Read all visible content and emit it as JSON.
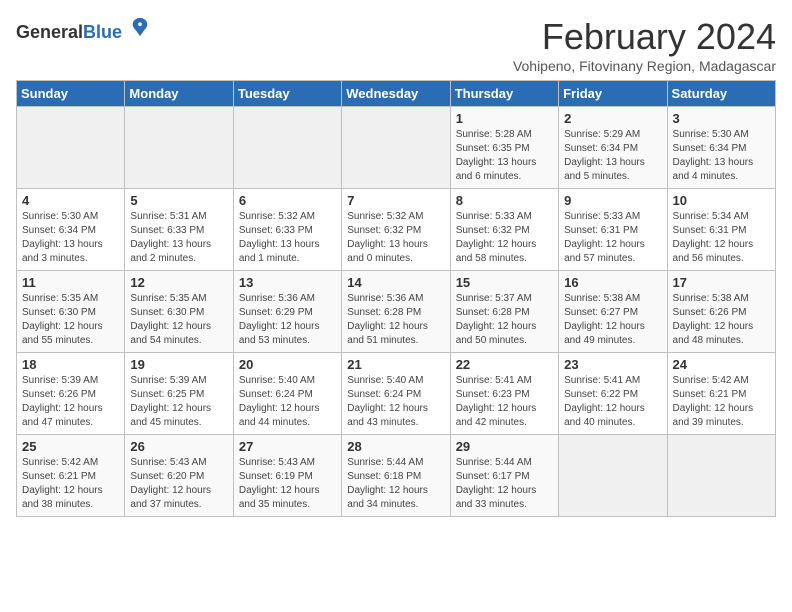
{
  "logo": {
    "general": "General",
    "blue": "Blue"
  },
  "header": {
    "month_title": "February 2024",
    "subtitle": "Vohipeno, Fitovinany Region, Madagascar"
  },
  "weekdays": [
    "Sunday",
    "Monday",
    "Tuesday",
    "Wednesday",
    "Thursday",
    "Friday",
    "Saturday"
  ],
  "weeks": [
    [
      {
        "day": "",
        "info": ""
      },
      {
        "day": "",
        "info": ""
      },
      {
        "day": "",
        "info": ""
      },
      {
        "day": "",
        "info": ""
      },
      {
        "day": "1",
        "info": "Sunrise: 5:28 AM\nSunset: 6:35 PM\nDaylight: 13 hours\nand 6 minutes."
      },
      {
        "day": "2",
        "info": "Sunrise: 5:29 AM\nSunset: 6:34 PM\nDaylight: 13 hours\nand 5 minutes."
      },
      {
        "day": "3",
        "info": "Sunrise: 5:30 AM\nSunset: 6:34 PM\nDaylight: 13 hours\nand 4 minutes."
      }
    ],
    [
      {
        "day": "4",
        "info": "Sunrise: 5:30 AM\nSunset: 6:34 PM\nDaylight: 13 hours\nand 3 minutes."
      },
      {
        "day": "5",
        "info": "Sunrise: 5:31 AM\nSunset: 6:33 PM\nDaylight: 13 hours\nand 2 minutes."
      },
      {
        "day": "6",
        "info": "Sunrise: 5:32 AM\nSunset: 6:33 PM\nDaylight: 13 hours\nand 1 minute."
      },
      {
        "day": "7",
        "info": "Sunrise: 5:32 AM\nSunset: 6:32 PM\nDaylight: 13 hours\nand 0 minutes."
      },
      {
        "day": "8",
        "info": "Sunrise: 5:33 AM\nSunset: 6:32 PM\nDaylight: 12 hours\nand 58 minutes."
      },
      {
        "day": "9",
        "info": "Sunrise: 5:33 AM\nSunset: 6:31 PM\nDaylight: 12 hours\nand 57 minutes."
      },
      {
        "day": "10",
        "info": "Sunrise: 5:34 AM\nSunset: 6:31 PM\nDaylight: 12 hours\nand 56 minutes."
      }
    ],
    [
      {
        "day": "11",
        "info": "Sunrise: 5:35 AM\nSunset: 6:30 PM\nDaylight: 12 hours\nand 55 minutes."
      },
      {
        "day": "12",
        "info": "Sunrise: 5:35 AM\nSunset: 6:30 PM\nDaylight: 12 hours\nand 54 minutes."
      },
      {
        "day": "13",
        "info": "Sunrise: 5:36 AM\nSunset: 6:29 PM\nDaylight: 12 hours\nand 53 minutes."
      },
      {
        "day": "14",
        "info": "Sunrise: 5:36 AM\nSunset: 6:28 PM\nDaylight: 12 hours\nand 51 minutes."
      },
      {
        "day": "15",
        "info": "Sunrise: 5:37 AM\nSunset: 6:28 PM\nDaylight: 12 hours\nand 50 minutes."
      },
      {
        "day": "16",
        "info": "Sunrise: 5:38 AM\nSunset: 6:27 PM\nDaylight: 12 hours\nand 49 minutes."
      },
      {
        "day": "17",
        "info": "Sunrise: 5:38 AM\nSunset: 6:26 PM\nDaylight: 12 hours\nand 48 minutes."
      }
    ],
    [
      {
        "day": "18",
        "info": "Sunrise: 5:39 AM\nSunset: 6:26 PM\nDaylight: 12 hours\nand 47 minutes."
      },
      {
        "day": "19",
        "info": "Sunrise: 5:39 AM\nSunset: 6:25 PM\nDaylight: 12 hours\nand 45 minutes."
      },
      {
        "day": "20",
        "info": "Sunrise: 5:40 AM\nSunset: 6:24 PM\nDaylight: 12 hours\nand 44 minutes."
      },
      {
        "day": "21",
        "info": "Sunrise: 5:40 AM\nSunset: 6:24 PM\nDaylight: 12 hours\nand 43 minutes."
      },
      {
        "day": "22",
        "info": "Sunrise: 5:41 AM\nSunset: 6:23 PM\nDaylight: 12 hours\nand 42 minutes."
      },
      {
        "day": "23",
        "info": "Sunrise: 5:41 AM\nSunset: 6:22 PM\nDaylight: 12 hours\nand 40 minutes."
      },
      {
        "day": "24",
        "info": "Sunrise: 5:42 AM\nSunset: 6:21 PM\nDaylight: 12 hours\nand 39 minutes."
      }
    ],
    [
      {
        "day": "25",
        "info": "Sunrise: 5:42 AM\nSunset: 6:21 PM\nDaylight: 12 hours\nand 38 minutes."
      },
      {
        "day": "26",
        "info": "Sunrise: 5:43 AM\nSunset: 6:20 PM\nDaylight: 12 hours\nand 37 minutes."
      },
      {
        "day": "27",
        "info": "Sunrise: 5:43 AM\nSunset: 6:19 PM\nDaylight: 12 hours\nand 35 minutes."
      },
      {
        "day": "28",
        "info": "Sunrise: 5:44 AM\nSunset: 6:18 PM\nDaylight: 12 hours\nand 34 minutes."
      },
      {
        "day": "29",
        "info": "Sunrise: 5:44 AM\nSunset: 6:17 PM\nDaylight: 12 hours\nand 33 minutes."
      },
      {
        "day": "",
        "info": ""
      },
      {
        "day": "",
        "info": ""
      }
    ]
  ]
}
